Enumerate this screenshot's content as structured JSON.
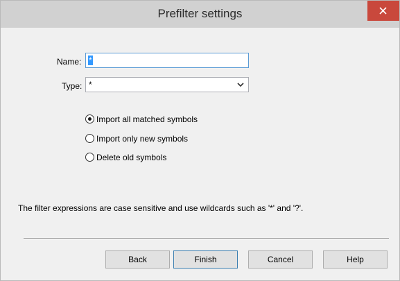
{
  "window": {
    "title": "Prefilter settings",
    "close_icon": "close-icon"
  },
  "form": {
    "name_label": "Name:",
    "name_value": "*",
    "type_label": "Type:",
    "type_value": "*"
  },
  "options": [
    {
      "label": "Import all matched symbols",
      "selected": true
    },
    {
      "label": "Import only new symbols",
      "selected": false
    },
    {
      "label": "Delete old symbols",
      "selected": false
    }
  ],
  "note": "The filter expressions are case sensitive and use wildcards such as '*' and '?'.",
  "buttons": {
    "back": "Back",
    "finish": "Finish",
    "cancel": "Cancel",
    "help": "Help"
  },
  "colors": {
    "close_button": "#c9483c",
    "selection": "#3399ff",
    "focus_border": "#5b9bd5"
  }
}
